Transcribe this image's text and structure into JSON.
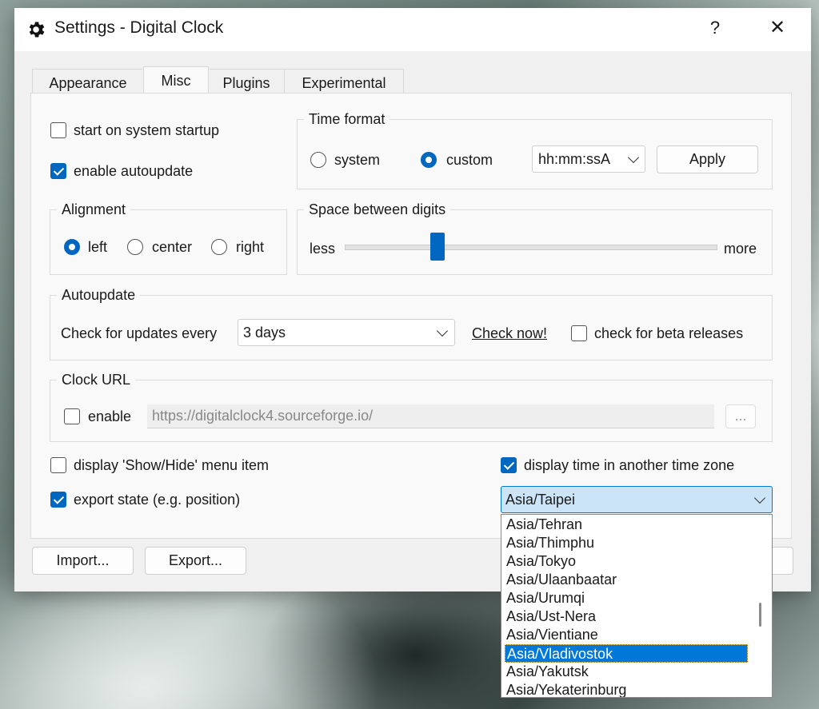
{
  "window": {
    "title": "Settings - Digital Clock",
    "help_label": "?",
    "close_label": "✕"
  },
  "tabs": [
    "Appearance",
    "Misc",
    "Plugins",
    "Experimental"
  ],
  "misc": {
    "start_on_startup": {
      "label": "start on system startup",
      "checked": false
    },
    "enable_autoupdate": {
      "label": "enable autoupdate",
      "checked": true
    }
  },
  "time_format": {
    "title": "Time format",
    "system_label": "system",
    "custom_label": "custom",
    "selected": "custom",
    "format_value": "hh:mm:ssA",
    "apply_label": "Apply"
  },
  "alignment": {
    "title": "Alignment",
    "options": [
      "left",
      "center",
      "right"
    ],
    "selected": "left"
  },
  "spacing": {
    "title": "Space between digits",
    "less_label": "less",
    "more_label": "more",
    "value_fraction": 0.24
  },
  "autoupdate": {
    "title": "Autoupdate",
    "check_label": "Check for updates every",
    "interval_value": "3 days",
    "check_now_label": "Check now!",
    "beta_label": "check for beta releases",
    "beta_checked": false
  },
  "clock_url": {
    "title": "Clock URL",
    "enable_label": "enable",
    "enabled": false,
    "url_value": "https://digitalclock4.sourceforge.io/",
    "browse_label": "..."
  },
  "options": {
    "show_hide": {
      "label": "display 'Show/Hide' menu item",
      "checked": false
    },
    "export_state": {
      "label": "export state (e.g. position)",
      "checked": true
    },
    "another_tz": {
      "label": "display time in another time zone",
      "checked": true
    },
    "timezone_value": "Asia/Taipei"
  },
  "timezone_list": [
    "Asia/Tehran",
    "Asia/Thimphu",
    "Asia/Tokyo",
    "Asia/Ulaanbaatar",
    "Asia/Urumqi",
    "Asia/Ust-Nera",
    "Asia/Vientiane",
    "Asia/Vladivostok",
    "Asia/Yakutsk",
    "Asia/Yekaterinburg"
  ],
  "timezone_highlighted": "Asia/Vladivostok",
  "footer": {
    "import_label": "Import...",
    "export_label": "Export..."
  },
  "colors": {
    "accent": "#0067c0",
    "selection": "#0078d7"
  }
}
